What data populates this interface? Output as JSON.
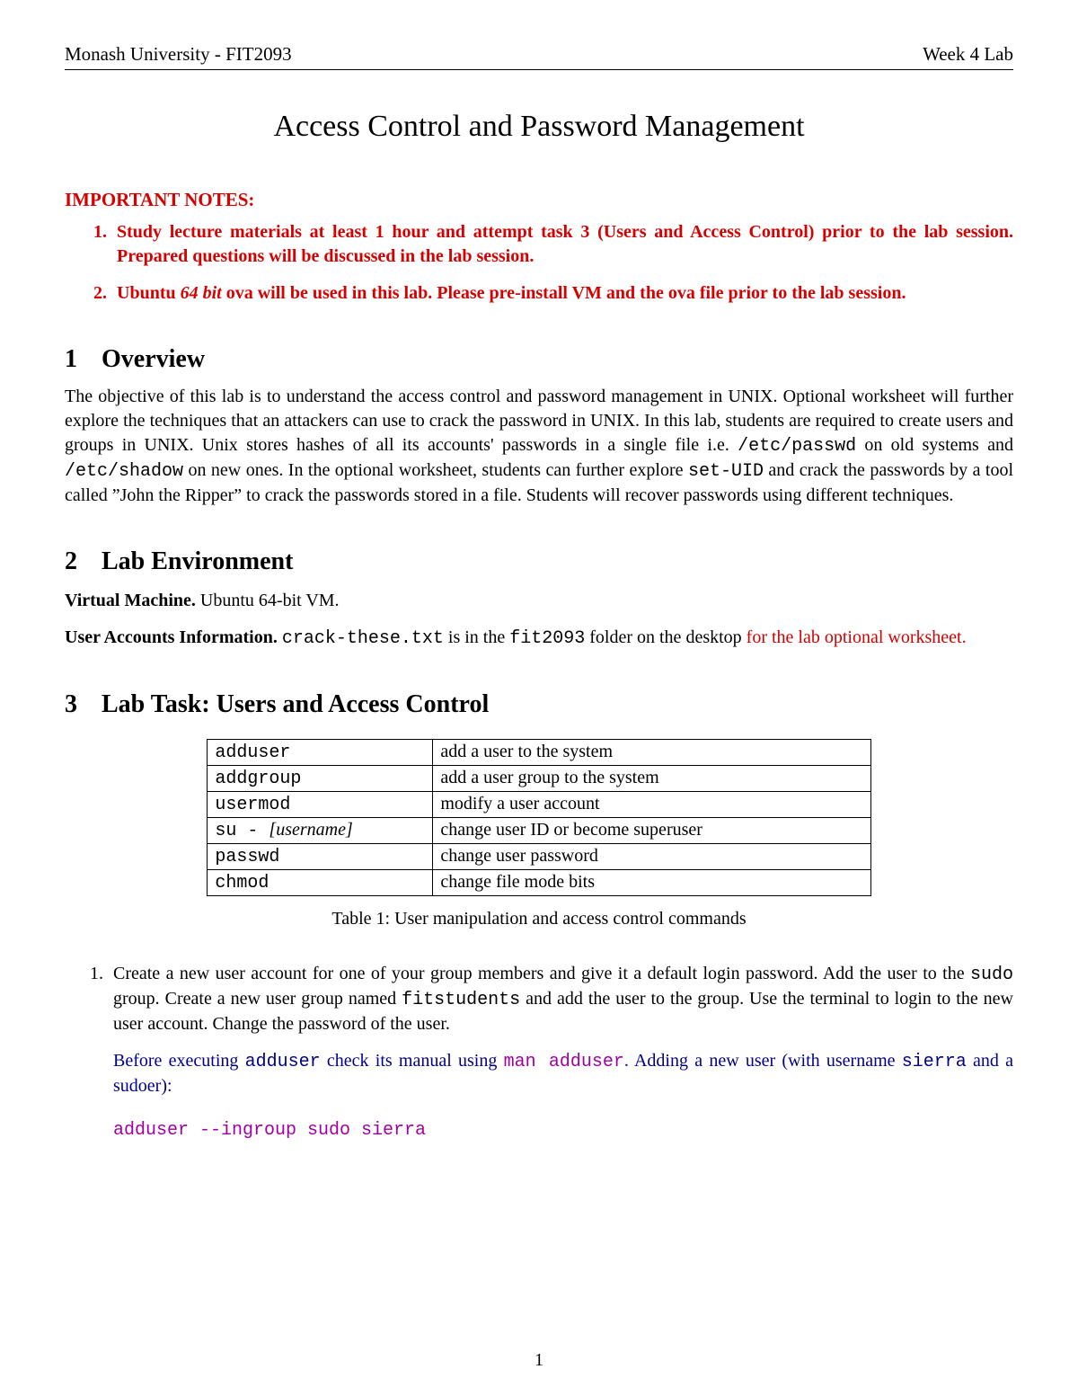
{
  "header": {
    "left": "Monash University - FIT2093",
    "right": "Week 4 Lab"
  },
  "title": "Access Control and Password Management",
  "important": {
    "label": "IMPORTANT NOTES:",
    "items": [
      {
        "pre": "Study lecture materials at least 1 hour and attempt task 3 (Users and Access Control) prior to the lab session. Prepared questions will be discussed in the lab session."
      },
      {
        "pre": "Ubuntu ",
        "em": "64 bit",
        "post": " ova will be used in this lab. Please pre-install VM and the ova file prior to the lab session."
      }
    ]
  },
  "sections": {
    "overview": {
      "num": "1",
      "title": "Overview",
      "p1a": "The objective of this lab is to understand the access control and password management in UNIX. Optional worksheet will further explore the techniques that an attackers can use to crack the password in UNIX. In this lab, students are required to create users and groups in UNIX. Unix stores hashes of all its accounts' passwords in a single file i.e. ",
      "code1": "/etc/passwd",
      "p1b": " on old systems and ",
      "code2": "/etc/shadow",
      "p1c": " on new ones. In the optional worksheet, students can further explore ",
      "code3": "set-UID",
      "p1d": " and crack the passwords by a tool called ”John the Ripper” to crack the passwords stored in a file. Students will recover passwords using different techniques."
    },
    "env": {
      "num": "2",
      "title": "Lab Environment",
      "vm_label": "Virtual Machine.",
      "vm_text": "  Ubuntu 64-bit VM.",
      "ua_label": "User Accounts Information.",
      "ua_a": "  ",
      "ua_code": "crack-these.txt",
      "ua_b": " is in the ",
      "ua_code2": "fit2093",
      "ua_c": " folder on the desktop ",
      "ua_red": "for the lab optional worksheet."
    },
    "task": {
      "num": "3",
      "title": "Lab Task: Users and Access Control",
      "table": {
        "rows": [
          {
            "cmd": "adduser",
            "args": "",
            "desc": "add a user to the system"
          },
          {
            "cmd": "addgroup",
            "args": "",
            "desc": "add a user group to the system"
          },
          {
            "cmd": "usermod",
            "args": "",
            "desc": "modify a user account"
          },
          {
            "cmd": "su - ",
            "args": "[username]",
            "desc": "change user ID or become superuser"
          },
          {
            "cmd": "passwd",
            "args": "",
            "desc": "change user password"
          },
          {
            "cmd": "chmod",
            "args": "",
            "desc": "change file mode bits"
          }
        ],
        "caption": "Table 1: User manipulation and access control commands"
      },
      "step1": {
        "a": "Create a new user account for one of your group members and give it a default login password. Add the user to the ",
        "code1": "sudo",
        "b": " group. Create a new user group named ",
        "code2": "fitstudents",
        "c": " and add the user to the group. Use the terminal to login to the new user account. Change the password of the user.",
        "note_a": "Before executing ",
        "note_code1": "adduser",
        "note_b": " check its manual using ",
        "note_code2": "man adduser",
        "note_c": ".  Adding a new user (with username ",
        "note_code3": "sierra",
        "note_d": " and a sudoer):",
        "cmd": "adduser --ingroup sudo sierra"
      }
    }
  },
  "page_number": "1"
}
